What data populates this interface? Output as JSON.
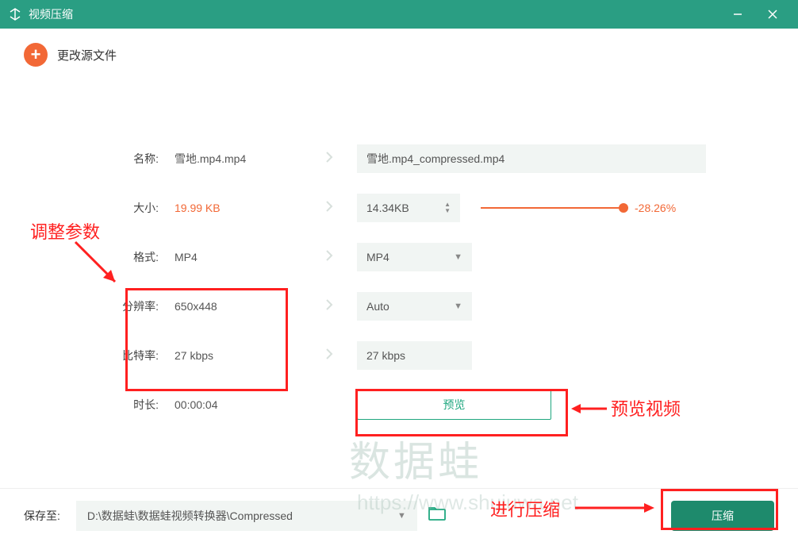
{
  "titlebar": {
    "title": "视频压缩"
  },
  "changeSource": {
    "label": "更改源文件"
  },
  "rows": {
    "name": {
      "label": "名称:",
      "value": "雪地.mp4.mp4",
      "out": "雪地.mp4_compressed.mp4"
    },
    "size": {
      "label": "大小:",
      "value": "19.99 KB",
      "out": "14.34KB",
      "percent": "-28.26%"
    },
    "format": {
      "label": "格式:",
      "value": "MP4",
      "out": "MP4"
    },
    "resolution": {
      "label": "分辨率:",
      "value": "650x448",
      "out": "Auto"
    },
    "bitrate": {
      "label": "比特率:",
      "value": "27 kbps",
      "out": "27 kbps"
    },
    "duration": {
      "label": "时长:",
      "value": "00:00:04"
    }
  },
  "preview": {
    "label": "预览"
  },
  "bottom": {
    "saveLabel": "保存至:",
    "path": "D:\\数据蛙\\数据蛙视频转换器\\Compressed",
    "compress": "压缩"
  },
  "annotations": {
    "adjustParams": "调整参数",
    "previewVideo": "预览视频",
    "doCompress": "进行压缩"
  },
  "watermark": {
    "text": "数据蛙",
    "url": "https://www.shujuwa.net"
  }
}
